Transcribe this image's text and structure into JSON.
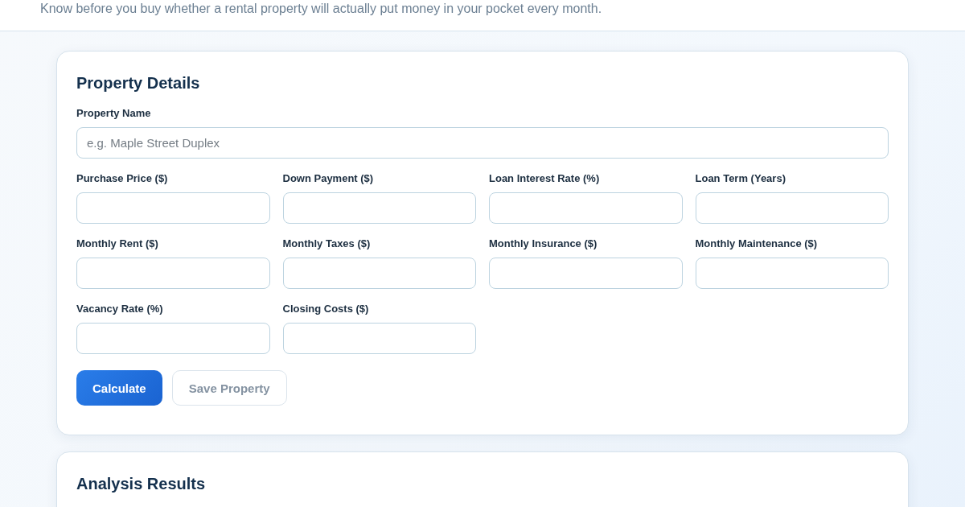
{
  "header": {
    "subtitle": "Know before you buy whether a rental property will actually put money in your pocket every month."
  },
  "property_details": {
    "title": "Property Details",
    "name_field": {
      "label": "Property Name",
      "placeholder": "e.g. Maple Street Duplex"
    },
    "fields": [
      {
        "label": "Purchase Price ($)"
      },
      {
        "label": "Down Payment ($)"
      },
      {
        "label": "Loan Interest Rate (%)"
      },
      {
        "label": "Loan Term (Years)"
      },
      {
        "label": "Monthly Rent ($)"
      },
      {
        "label": "Monthly Taxes ($)"
      },
      {
        "label": "Monthly Insurance ($)"
      },
      {
        "label": "Monthly Maintenance ($)"
      },
      {
        "label": "Vacancy Rate (%)"
      },
      {
        "label": "Closing Costs ($)"
      }
    ],
    "actions": [
      {
        "label": "Calculate",
        "kind": "primary"
      },
      {
        "label": "Save Property",
        "kind": "secondary"
      }
    ]
  },
  "analysis_results": {
    "title": "Analysis Results"
  }
}
